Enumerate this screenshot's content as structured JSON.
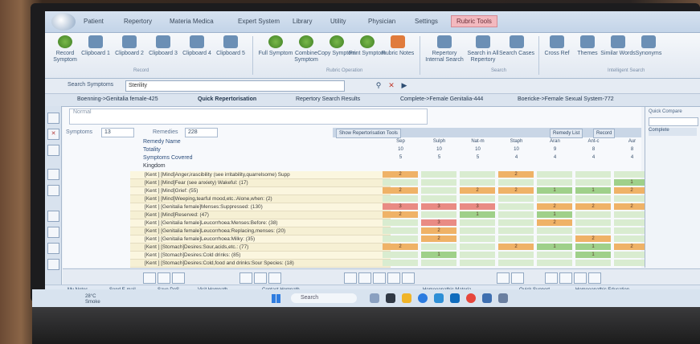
{
  "tabs": [
    "Patient",
    "Repertory",
    "Materia Medica",
    "Expert System",
    "Library",
    "Utility",
    "Physician",
    "Settings",
    "Rubric Tools"
  ],
  "ribbon": {
    "record": [
      "Record Symptom",
      "Clipboard 1",
      "Clipboard 2",
      "Clipboard 3",
      "Clipboard 4",
      "Clipboard 5"
    ],
    "record_group": "Record",
    "rubric_ops": [
      "Full Symptom",
      "Combine Symptom",
      "Copy Symptom",
      "Print Symptom",
      "Rubric Notes"
    ],
    "rubric_ops_group": "Rubric Operation",
    "search": [
      "Repertory Internal Search",
      "Search in All Repertory",
      "Search Cases"
    ],
    "search_group": "Search",
    "intel": [
      "Cross Ref",
      "Themes",
      "Similar Words",
      "Synonyms"
    ],
    "intel_group": "Intelligent Search"
  },
  "searchbar": {
    "label": "Search Symptoms",
    "value": "Sterility"
  },
  "subtabs": [
    "Boenning->Genitalia female-425",
    "Quick Repertorisation",
    "Repertory Search Results",
    "Complete->Female Genitalia-444",
    "Boericke->Female Sexual System-772"
  ],
  "normal_placeholder": "Normal",
  "counts": {
    "symptoms_label": "Symptoms",
    "symptoms": "13",
    "remedies_label": "Remedies",
    "remedies": "228"
  },
  "toolbar": {
    "show": "Show Repertorisation Tools",
    "remedy_list": "Remedy List",
    "record": "Record"
  },
  "rows": {
    "name": "Remedy Name",
    "totality": "Totality",
    "covered": "Symptoms Covered",
    "kingdom": "Kingdom"
  },
  "remedies": [
    {
      "name": "Sep",
      "totality": "10",
      "covered": "5"
    },
    {
      "name": "Sulph",
      "totality": "10",
      "covered": "5"
    },
    {
      "name": "Nat-m",
      "totality": "10",
      "covered": "5"
    },
    {
      "name": "Staph",
      "totality": "10",
      "covered": "4"
    },
    {
      "name": "Aran",
      "totality": "9",
      "covered": "4"
    },
    {
      "name": "Ant-c",
      "totality": "8",
      "covered": "4"
    },
    {
      "name": "Aur",
      "totality": "8",
      "covered": "4"
    },
    {
      "name": "Bor",
      "totality": "8",
      "covered": "4"
    }
  ],
  "rubrics": [
    "[Kent ] [Mind]Anger,irascibility (see irritability,quarrelsome) Supp",
    "[Kent ] [Mind]Fear (see anxiety) Wakeful: (17)",
    "[Kent ] [Mind]Grief: (55)",
    "[Kent ] [Mind]Weeping,tearful mood,etc.:Alone,when: (2)",
    "[Kent ] [Genitalia female]Menses:Suppressed: (130)",
    "[Kent ] [Mind]Reserved: (47)",
    "[Kent ] [Genitalia female]Leucorrhoea:Menses:Before: (38)",
    "[Kent ] [Genitalia female]Leucorrhoea:Replacing,menses: (20)",
    "[Kent ] [Genitalia female]Leucorrhoea:Milky: (35)",
    "[Kent ] [Stomach]Desires:Sour,acids,etc.: (77)",
    "[Kent ] [Stomach]Desires:Cold drinks: (85)",
    "[Kent ] [Stomach]Desires:Cold,food and drinks:Sour Species: (18)"
  ],
  "grid_values": [
    [
      "2",
      "",
      "",
      "2",
      "",
      "",
      "",
      ""
    ],
    [
      "",
      "",
      "",
      "",
      "",
      "",
      "1",
      ""
    ],
    [
      "2",
      "",
      "2",
      "2",
      "1",
      "1",
      "2",
      "1"
    ],
    [
      "",
      "",
      "",
      "",
      "",
      "",
      "",
      ""
    ],
    [
      "3",
      "3",
      "3",
      "",
      "2",
      "2",
      "2",
      "2"
    ],
    [
      "2",
      "",
      "1",
      "",
      "1",
      "",
      "",
      ""
    ],
    [
      "",
      "3",
      "",
      "",
      "2",
      "",
      "",
      ""
    ],
    [
      "",
      "2",
      "",
      "",
      "",
      "",
      "",
      ""
    ],
    [
      "",
      "2",
      "",
      "",
      "",
      "2",
      "",
      ""
    ],
    [
      "2",
      "",
      "",
      "2",
      "1",
      "1",
      "2",
      "1"
    ],
    [
      "",
      "1",
      "",
      "",
      "",
      "1",
      "",
      ""
    ],
    [
      "",
      "",
      "",
      "",
      "",
      "",
      "",
      ""
    ]
  ],
  "colors": {
    "red": "#e98b84",
    "orange": "#efb267",
    "green": "#9fd08a",
    "light": "#d9ecd0"
  },
  "rightpane": {
    "tab": "Quick Compare",
    "head": "Complete"
  },
  "apps": [
    "My Notes",
    "Send E-mail",
    "Save DoS",
    "Visit Hompath",
    "Contact Hompath",
    "Homoeopathic Materia",
    "Quick Support",
    "Homoeopathic Education"
  ],
  "winbar": {
    "weather_temp": "28°C",
    "weather_text": "Smoke",
    "search": "Search"
  }
}
